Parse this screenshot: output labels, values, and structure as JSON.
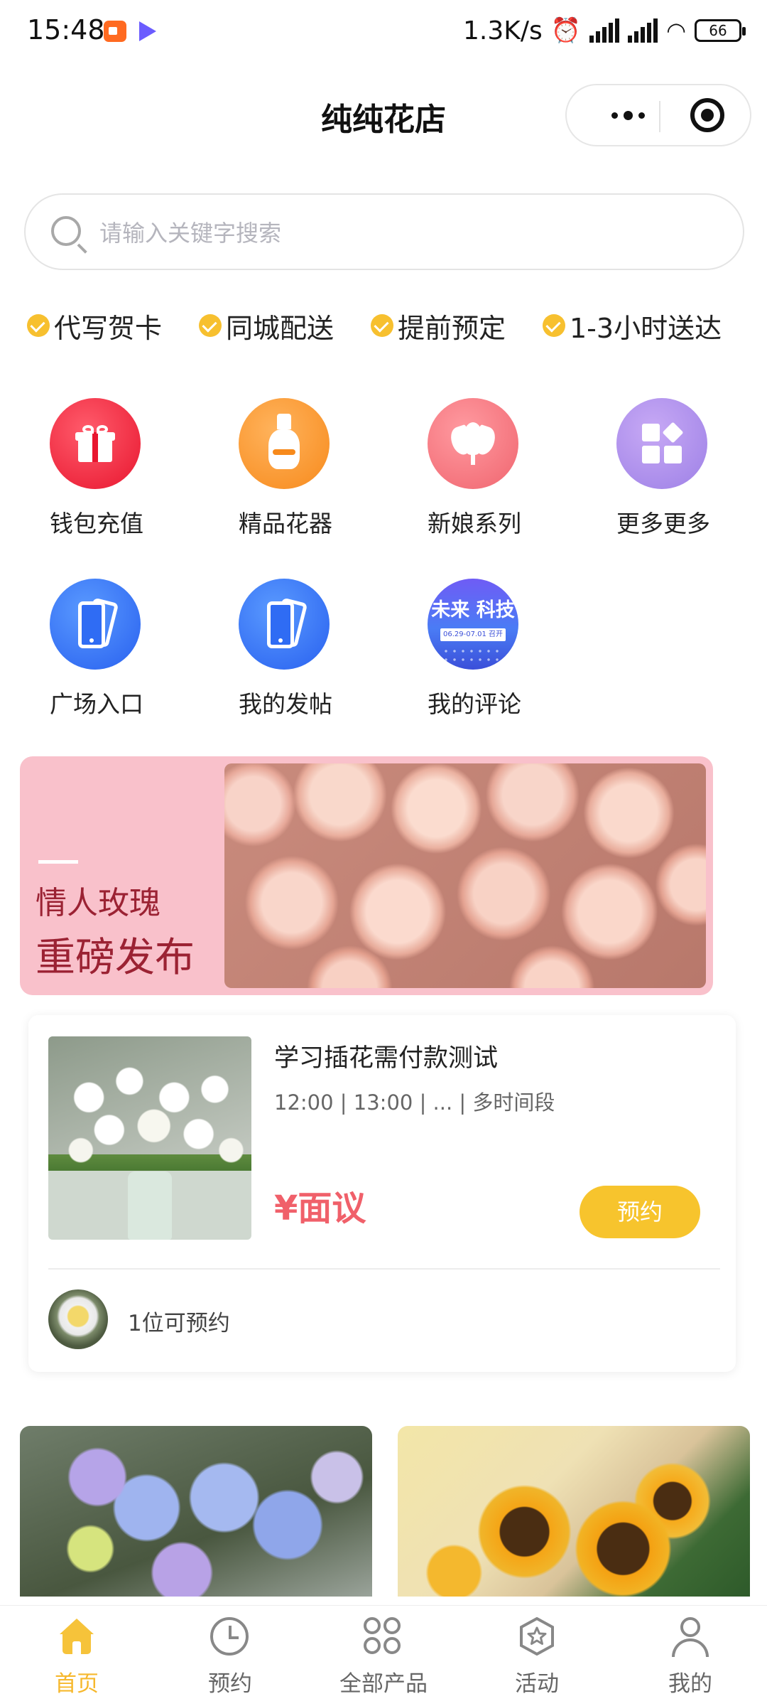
{
  "status_bar": {
    "time": "15:48",
    "network_speed": "1.3K/s",
    "battery": "66",
    "icons": [
      "video-app-icon",
      "play-store-icon",
      "alarm-icon",
      "signal-hd-icon",
      "signal-hd-icon",
      "wifi-icon",
      "battery-icon"
    ]
  },
  "header": {
    "title": "纯纯花店",
    "more_icon": "more-dots-icon",
    "close_icon": "target-close-icon"
  },
  "search": {
    "placeholder": "请输入关键字搜索",
    "icon": "search-icon"
  },
  "features": [
    {
      "label": "代写贺卡"
    },
    {
      "label": "同城配送"
    },
    {
      "label": "提前预定"
    },
    {
      "label": "1-3小时送达"
    }
  ],
  "grid": [
    {
      "label": "钱包充值",
      "icon": "gift-icon",
      "color": "#e8162f"
    },
    {
      "label": "精品花器",
      "icon": "vase-icon",
      "color": "#f78a1c"
    },
    {
      "label": "新娘系列",
      "icon": "tulip-icon",
      "color": "#f0656f"
    },
    {
      "label": "更多更多",
      "icon": "apps-icon",
      "color": "#9d80e6"
    },
    {
      "label": "广场入口",
      "icon": "phone-icon",
      "color": "#2860ef"
    },
    {
      "label": "我的发帖",
      "icon": "phone-icon",
      "color": "#2860ef"
    },
    {
      "label": "我的评论",
      "icon": "promo-image",
      "promo_title": "未来 科技",
      "promo_date": "06.29-07.01 召开"
    }
  ],
  "banner": {
    "line1": "情人玫瑰",
    "line2": "重磅发布"
  },
  "card": {
    "title": "学习插花需付款测试",
    "times": "12:00 | 13:00 | ... | 多时间段",
    "price": "¥面议",
    "book_label": "预约",
    "count": "1位可预约"
  },
  "tabs": [
    {
      "label": "首页",
      "icon": "home-icon",
      "active": true
    },
    {
      "label": "预约",
      "icon": "clock-icon",
      "active": false
    },
    {
      "label": "全部产品",
      "icon": "grid-icon",
      "active": false
    },
    {
      "label": "活动",
      "icon": "star-badge-icon",
      "active": false
    },
    {
      "label": "我的",
      "icon": "user-icon",
      "active": false
    }
  ],
  "colors": {
    "accent": "#f7c42d",
    "price": "#f0606a",
    "banner_bg": "#f9c1cb",
    "banner_text": "#9b2233"
  }
}
